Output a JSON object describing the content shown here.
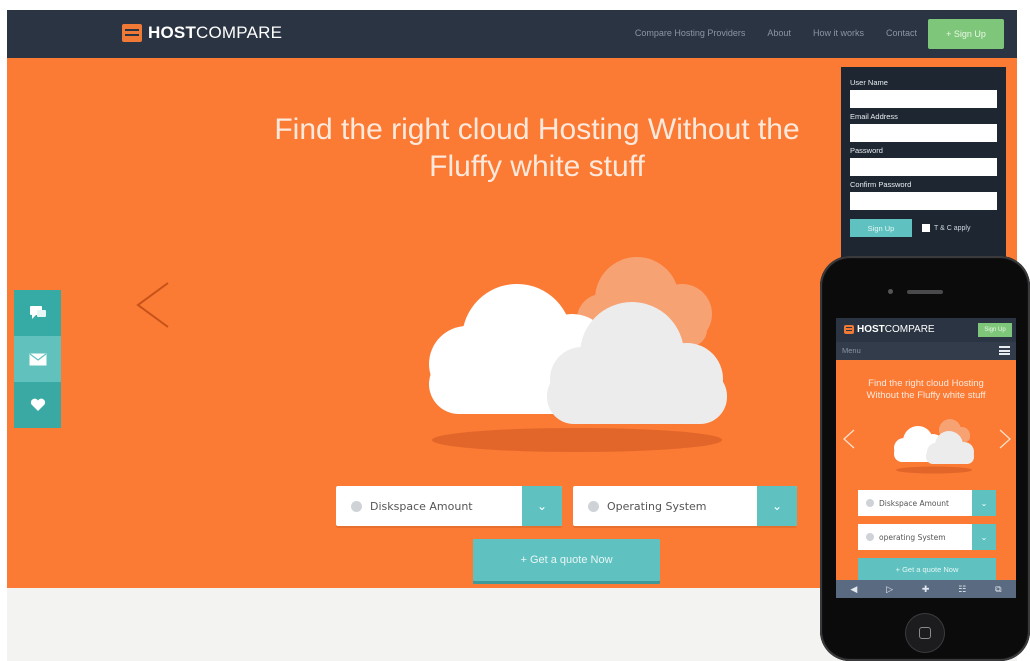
{
  "brand": {
    "bold": "HOST",
    "light": "COMPARE"
  },
  "nav": {
    "links": [
      "Compare Hosting Providers",
      "About",
      "How it works",
      "Contact"
    ],
    "signup_label": "+ Sign Up"
  },
  "hero": {
    "title_line1": "Find the right cloud Hosting Without the",
    "title_line2": "Fluffy white stuff",
    "diskspace_label": "Diskspace Amount",
    "os_label": "Operating System",
    "quote_label": "+ Get a quote Now"
  },
  "social": {
    "icons": [
      "chat-icon",
      "mail-icon",
      "heart-icon"
    ]
  },
  "signup_form": {
    "username_label": "User Name",
    "email_label": "Email Address",
    "password_label": "Password",
    "confirm_label": "Confirm Password",
    "submit_label": "Sign Up",
    "terms_label": "T & C apply"
  },
  "mobile": {
    "signup_label": "Sign Up",
    "menu_label": "Menu",
    "title_line1": "Find the right cloud Hosting",
    "title_line2": "Without the Fluffy white stuff",
    "diskspace_label": "Diskspace Amount",
    "os_label": "operating System",
    "quote_label": "+ Get a quote Now"
  },
  "colors": {
    "navbar": "#2b3442",
    "hero": "#fb7a34",
    "accent_teal": "#5fc2c0",
    "signup_green": "#7ec77a"
  }
}
